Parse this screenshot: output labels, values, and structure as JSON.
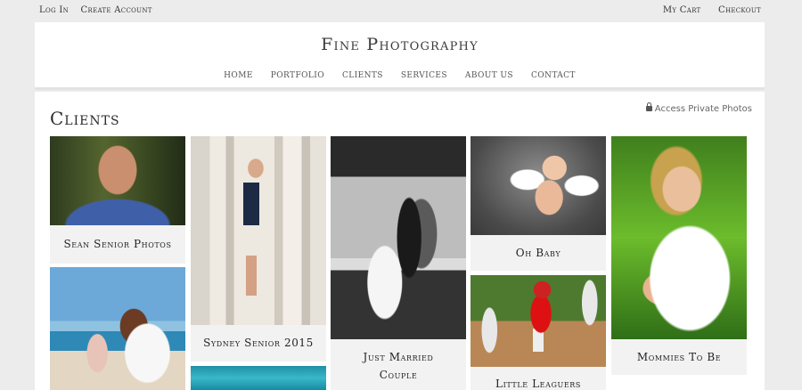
{
  "topbar": {
    "left_links": [
      "Log In",
      "Create Account"
    ],
    "right_links": [
      "My Cart",
      "Checkout"
    ]
  },
  "site": {
    "title": "Fine Photography",
    "nav": [
      "HOME",
      "PORTFOLIO",
      "CLIENTS",
      "SERVICES",
      "ABOUT US",
      "CONTACT"
    ]
  },
  "page": {
    "title": "Clients",
    "private_link": "Access Private Photos"
  },
  "galleries": [
    {
      "caption": "Sean Senior Photos",
      "photo": "senior portrait of young man in blue shirt"
    },
    {
      "caption": "Sydney Senior 2015",
      "photo": "young woman in navy dress by columns"
    },
    {
      "caption": "Just Married Couple",
      "photo": "black and white wedding couple"
    },
    {
      "caption": "Oh Baby",
      "photo": "baby with angel wings"
    },
    {
      "caption": "Little Leaguers",
      "photo": "young baseball players running"
    },
    {
      "caption": "Mommies To Be",
      "photo": "pregnant woman in grass"
    },
    {
      "caption": "",
      "photo": "mother and child on beach"
    },
    {
      "caption": "",
      "photo": "turquoise water"
    }
  ]
}
